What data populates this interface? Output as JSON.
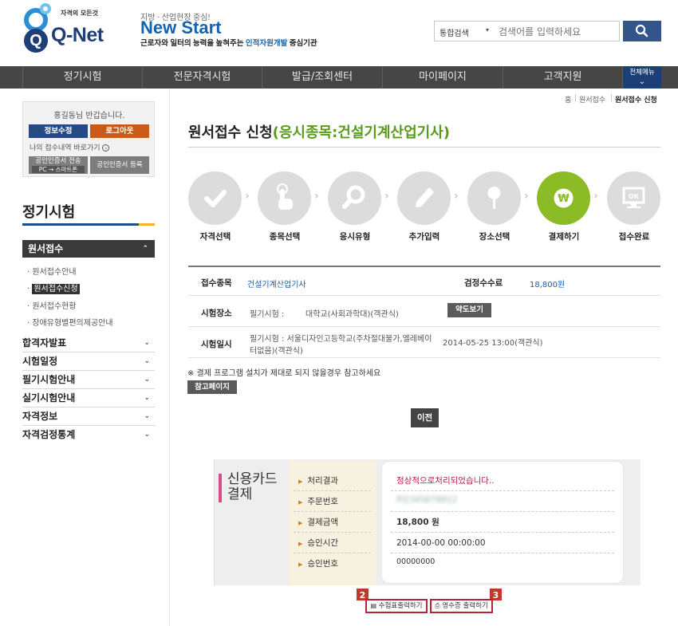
{
  "header": {
    "logo_small": "자격의 모든것",
    "logo_text": "Q-Net",
    "new_start_tag": "지방 · 산업현장 중심!",
    "new_start_title": "New Start",
    "new_start_desc_pre": "근로자와 일터의 능력을 높혀주는 ",
    "new_start_desc_hl": "인적자원개발",
    "new_start_desc_post": " 중심기관",
    "search_scope": "통합검색",
    "search_placeholder": "검색어를 입력하세요",
    "search_icon": "search-icon"
  },
  "gnb": {
    "items": [
      "정기시험",
      "전문자격시험",
      "발급/조회센터",
      "마이페이지",
      "고객지원"
    ],
    "all_menu": "전체메뉴"
  },
  "sidebar": {
    "welcome": "홍길동님 반갑습니다.",
    "profile_btn": "정보수정",
    "logout_btn": "로그아웃",
    "my_history_link": "나의 접수내역 바로가기",
    "cert_transfer_btn_1": "공인인증서 전송",
    "cert_transfer_btn_2": "PC → 스마트폰",
    "cert_register_btn": "공인인증서 등록",
    "section_title": "정기시험",
    "sub_head": "원서접수",
    "sub_items": [
      "원서접수안내",
      "원서접수신청",
      "원서접수현황",
      "장애유형별편의제공안내"
    ],
    "active_sub_index": 1,
    "menu": [
      "합격자발표",
      "시험일정",
      "필기시험안내",
      "실기시험안내",
      "자격정보",
      "자격검정통계"
    ]
  },
  "breadcrumb": [
    "홈",
    "원서접수",
    "원서접수 신청"
  ],
  "page": {
    "title_main": "원서접수 신청",
    "title_sub": "(응시종목:건설기계산업기사)"
  },
  "steps": {
    "labels": [
      "자격선택",
      "종목선택",
      "응시유형",
      "추가입력",
      "장소선택",
      "결제하기",
      "접수완료"
    ],
    "active_index": 5,
    "icons": [
      "check-icon",
      "hand-pointer-icon",
      "magnifier-icon",
      "pencil-icon",
      "location-pin-icon",
      "won-icon",
      "ok-monitor-icon"
    ],
    "active_color": "#8bbb25"
  },
  "info": {
    "subject_label": "접수종목",
    "subject_value": "건설기계산업기사",
    "fee_label": "검정수수료",
    "fee_value": "18,800원",
    "place_label": "시험장소",
    "place_written": "필기시험 :",
    "place_value": "대학교(사회과학대)(객관식)",
    "map_btn": "약도보기",
    "date_label": "시험일시",
    "date_place_1": "필기시험 : 서울디자인고등학교(주차절대불가,엘레베이",
    "date_place_2": "터없음)(객관식)",
    "date_value": "2014-05-25 13:00(객관식)"
  },
  "notice": {
    "text": "※ 결제 프로그램 설치가 제대로 되지 않을경우 참고하세요",
    "ref_btn": "참고페이지",
    "prev_btn": "이전"
  },
  "payment": {
    "title_1": "신용카드",
    "title_2": "결제",
    "labels": [
      "처리결과",
      "주문번호",
      "결제금액",
      "승인시간",
      "승인번호"
    ],
    "result": "정상적으로처리되었습니다..",
    "order_no": "PI2345678912",
    "amount": "18,800 원",
    "approval_time": "2014-00-00 00:00:00",
    "approval_no": "00000000",
    "result_color": "#b0234a"
  },
  "bottom": {
    "receipt_print": "수험표출력하기",
    "receipt_badge": "2",
    "bill_print": "영수증 출력하기",
    "bill_badge": "3"
  }
}
